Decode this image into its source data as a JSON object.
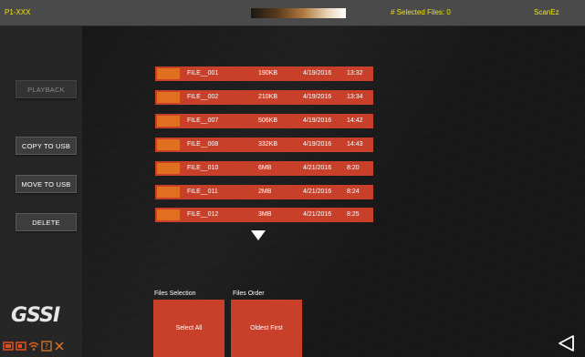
{
  "topbar": {
    "project": "P1-XXX",
    "selected_files": "# Selected Files: 0",
    "app_name": "ScanEz"
  },
  "sidebar": {
    "buttons": [
      {
        "label": "PLAYBACK",
        "enabled": false
      },
      {
        "label": "COPY TO USB",
        "enabled": true
      },
      {
        "label": "MOVE TO USB",
        "enabled": true
      },
      {
        "label": "DELETE",
        "enabled": true
      }
    ],
    "logo_text": "GSSI"
  },
  "files": [
    {
      "name": "FILE__001",
      "size": "190KB",
      "date": "4/19/2016",
      "time": "13:32"
    },
    {
      "name": "FILE__002",
      "size": "210KB",
      "date": "4/19/2016",
      "time": "13:34"
    },
    {
      "name": "FILE__007",
      "size": "506KB",
      "date": "4/19/2016",
      "time": "14:42"
    },
    {
      "name": "FILE__008",
      "size": "332KB",
      "date": "4/19/2016",
      "time": "14:43"
    },
    {
      "name": "FILE__010",
      "size": "6MB",
      "date": "4/21/2016",
      "time": "8:20"
    },
    {
      "name": "FILE__011",
      "size": "2MB",
      "date": "4/21/2016",
      "time": "8:24"
    },
    {
      "name": "FILE__012",
      "size": "3MB",
      "date": "4/21/2016",
      "time": "8:25"
    }
  ],
  "options": {
    "selection_label": "Files Selection",
    "selection_value": "Select All",
    "order_label": "Files Order",
    "order_value": "Oldest First"
  },
  "colors": {
    "accent": "#c8402a",
    "chip": "#e07020",
    "status_text": "#f5e400"
  },
  "icons": {
    "scroll": "chevron-down-icon",
    "back": "back-triangle-icon"
  }
}
